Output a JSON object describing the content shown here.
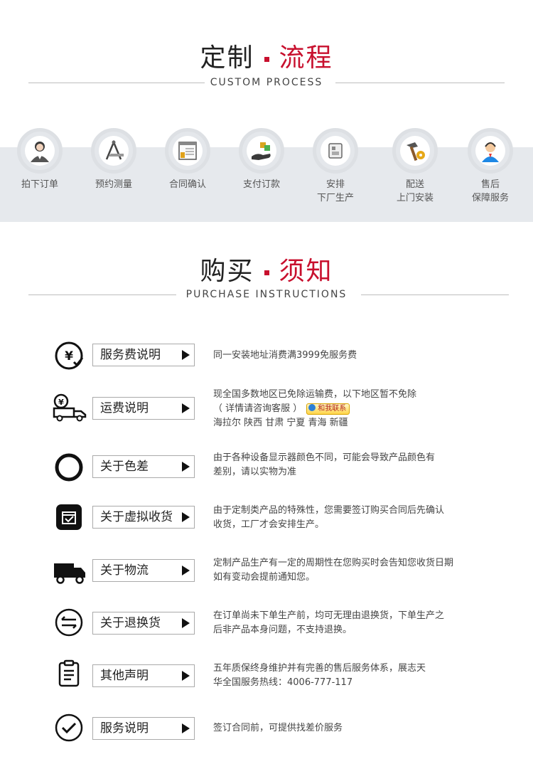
{
  "process": {
    "title_main": "定制",
    "title_accent": "流程",
    "subtitle": "CUSTOM PROCESS",
    "steps": [
      {
        "line1": "拍下订单",
        "line2": "",
        "icon": "customer-service-woman-icon"
      },
      {
        "line1": "预约测量",
        "line2": "",
        "icon": "measuring-tools-icon"
      },
      {
        "line1": "合同确认",
        "line2": "",
        "icon": "contract-document-icon"
      },
      {
        "line1": "支付订款",
        "line2": "",
        "icon": "payment-hand-icon"
      },
      {
        "line1": "安排",
        "line2": "下厂生产",
        "icon": "production-icon"
      },
      {
        "line1": "配送",
        "line2": "上门安装",
        "icon": "install-tools-icon"
      },
      {
        "line1": "售后",
        "line2": "保障服务",
        "icon": "after-sales-agent-icon"
      }
    ]
  },
  "purchase": {
    "title_main": "购买",
    "title_accent": "须知",
    "subtitle": "PURCHASE INSTRUCTIONS",
    "items": [
      {
        "label": "服务费说明",
        "icon": "yen-check-icon",
        "lines": [
          "同一安装地址消费满3999免服务费"
        ]
      },
      {
        "label": "运费说明",
        "icon": "yen-truck-icon",
        "lines": [
          "现全国多数地区已免除运输费，以下地区暂不免除",
          "（ 详情请咨询客服 ）",
          "海拉尔 陕西 甘肃 宁夏 青海 新疆"
        ],
        "badge": "和我联系"
      },
      {
        "label": "关于色差",
        "icon": "color-ring-icon",
        "lines": [
          "由于各种设备显示器颜色不同，可能会导致产品颜色有",
          "差别，请以实物为准"
        ]
      },
      {
        "label": "关于虚拟收货",
        "icon": "package-check-icon",
        "lines": [
          "由于定制类产品的特殊性，您需要签订购买合同后先确认",
          "收货，工厂才会安排生产。"
        ]
      },
      {
        "label": "关于物流",
        "icon": "delivery-truck-icon",
        "lines": [
          "定制产品生产有一定的周期性在您购买时会告知您收货日期",
          "如有变动会提前通知您。"
        ]
      },
      {
        "label": "关于退换货",
        "icon": "exchange-arrows-icon",
        "lines": [
          "在订单尚未下单生产前，均可无理由退换货，下单生产之",
          "后非产品本身问题，不支持退换。"
        ]
      },
      {
        "label": "其他声明",
        "icon": "clipboard-icon",
        "lines": [
          "五年质保终身维护并有完善的售后服务体系，展志天",
          "华全国服务热线：4006-777-117"
        ]
      },
      {
        "label": "服务说明",
        "icon": "check-circle-icon",
        "lines": [
          "签订合同前，可提供找差价服务"
        ]
      }
    ]
  }
}
